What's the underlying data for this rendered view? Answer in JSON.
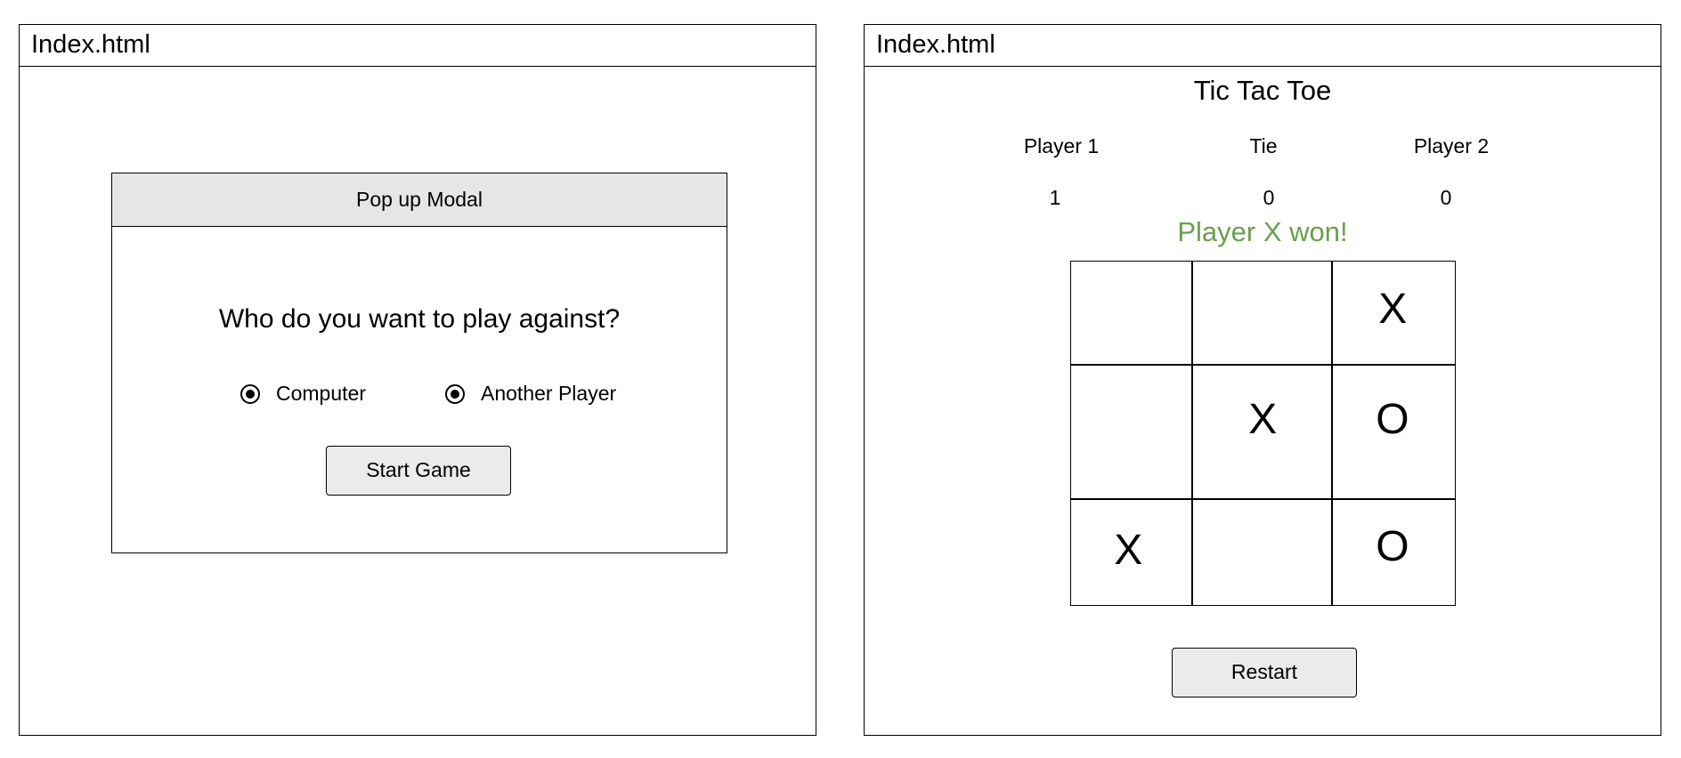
{
  "left_page": {
    "title": "Index.html",
    "modal": {
      "header": "Pop up Modal",
      "question": "Who do you want to play against?",
      "options": [
        {
          "label": "Computer",
          "selected": true
        },
        {
          "label": "Another Player",
          "selected": true
        }
      ],
      "start_button": "Start Game"
    }
  },
  "right_page": {
    "title": "Index.html",
    "game_title": "Tic Tac Toe",
    "scoreboard": {
      "player1": {
        "label": "Player 1",
        "score": "1"
      },
      "tie": {
        "label": "Tie",
        "score": "0"
      },
      "player2": {
        "label": "Player 2",
        "score": "0"
      }
    },
    "status": "Player X won!",
    "status_color": "#6a9f4c",
    "board": [
      [
        "",
        "",
        "X"
      ],
      [
        "",
        "X",
        "O"
      ],
      [
        "X",
        "",
        "O"
      ]
    ],
    "restart_button": "Restart"
  },
  "colors": {
    "modal_header_bg": "#e6e6e6",
    "button_bg": "#ebebeb"
  }
}
